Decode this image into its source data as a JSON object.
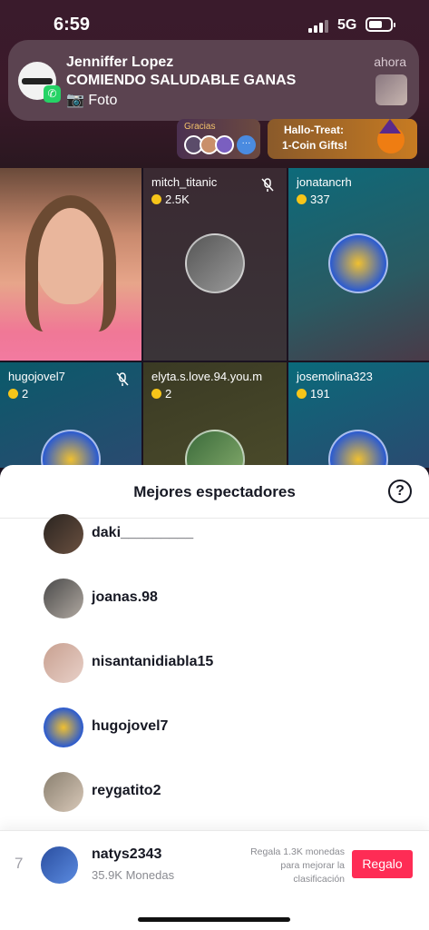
{
  "status_bar": {
    "time": "6:59",
    "network": "5G",
    "icons": [
      "signal-icon",
      "battery-icon"
    ]
  },
  "notification": {
    "sender": "Jenniffer Lopez",
    "subtitle": "COMIENDO SALUDABLE GANAS",
    "body": "📷 Foto",
    "time": "ahora",
    "app_icon": "whatsapp-icon"
  },
  "banners": {
    "gracias_label": "Gracias",
    "more_label": "···",
    "hallo_line1": "Hallo-Treat:",
    "hallo_line2": "1-Coin Gifts!"
  },
  "grid": {
    "cells": [
      {
        "name": "mitch_titanic",
        "coins": "2.5K",
        "muted": true
      },
      {
        "name": "jonatancrh",
        "coins": "337",
        "muted": false
      },
      {
        "name": "hugojovel7",
        "coins": "2",
        "muted": true
      },
      {
        "name": "elyta.s.love.94.you.m",
        "coins": "2",
        "muted": false
      },
      {
        "name": "josemolina323",
        "coins": "191",
        "muted": false
      }
    ]
  },
  "sheet": {
    "title": "Mejores espectadores",
    "help_icon": "?",
    "viewers": [
      {
        "name": "daki_________"
      },
      {
        "name": "joanas.98"
      },
      {
        "name": "nisantanidiabla15"
      },
      {
        "name": "hugojovel7"
      },
      {
        "name": "reygatito2"
      }
    ]
  },
  "footer": {
    "rank": "7",
    "name": "natys2343",
    "coins": "35.9K Monedas",
    "hint": "Regala 1.3K monedas para mejorar la clasificación",
    "button_label": "Regalo"
  },
  "colors": {
    "accent": "#fe2c55",
    "coin": "#f6c519",
    "whatsapp": "#25d366"
  }
}
